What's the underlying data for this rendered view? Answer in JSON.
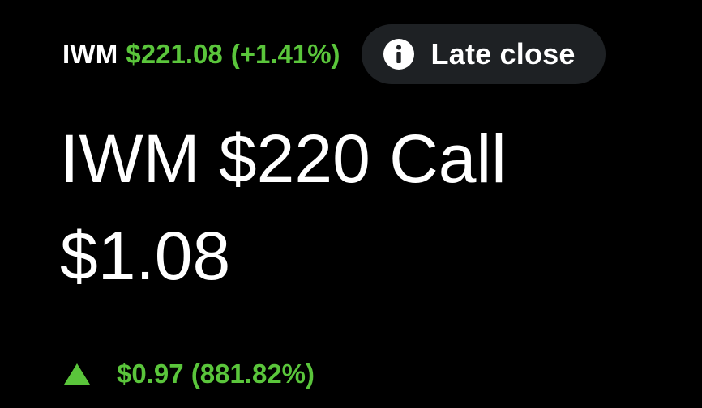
{
  "header": {
    "ticker": "IWM",
    "underlying_price": "$221.08",
    "underlying_change": "(+1.41%)",
    "late_close_label": "Late close",
    "info_icon": "info-icon"
  },
  "contract": {
    "title": "IWM $220 Call",
    "price": "$1.08"
  },
  "change": {
    "direction_icon": "triangle-up-icon",
    "text": "$0.97 (881.82%)"
  },
  "colors": {
    "background": "#000000",
    "text": "#ffffff",
    "positive": "#5ac53b",
    "pill_background": "#1e2124"
  }
}
